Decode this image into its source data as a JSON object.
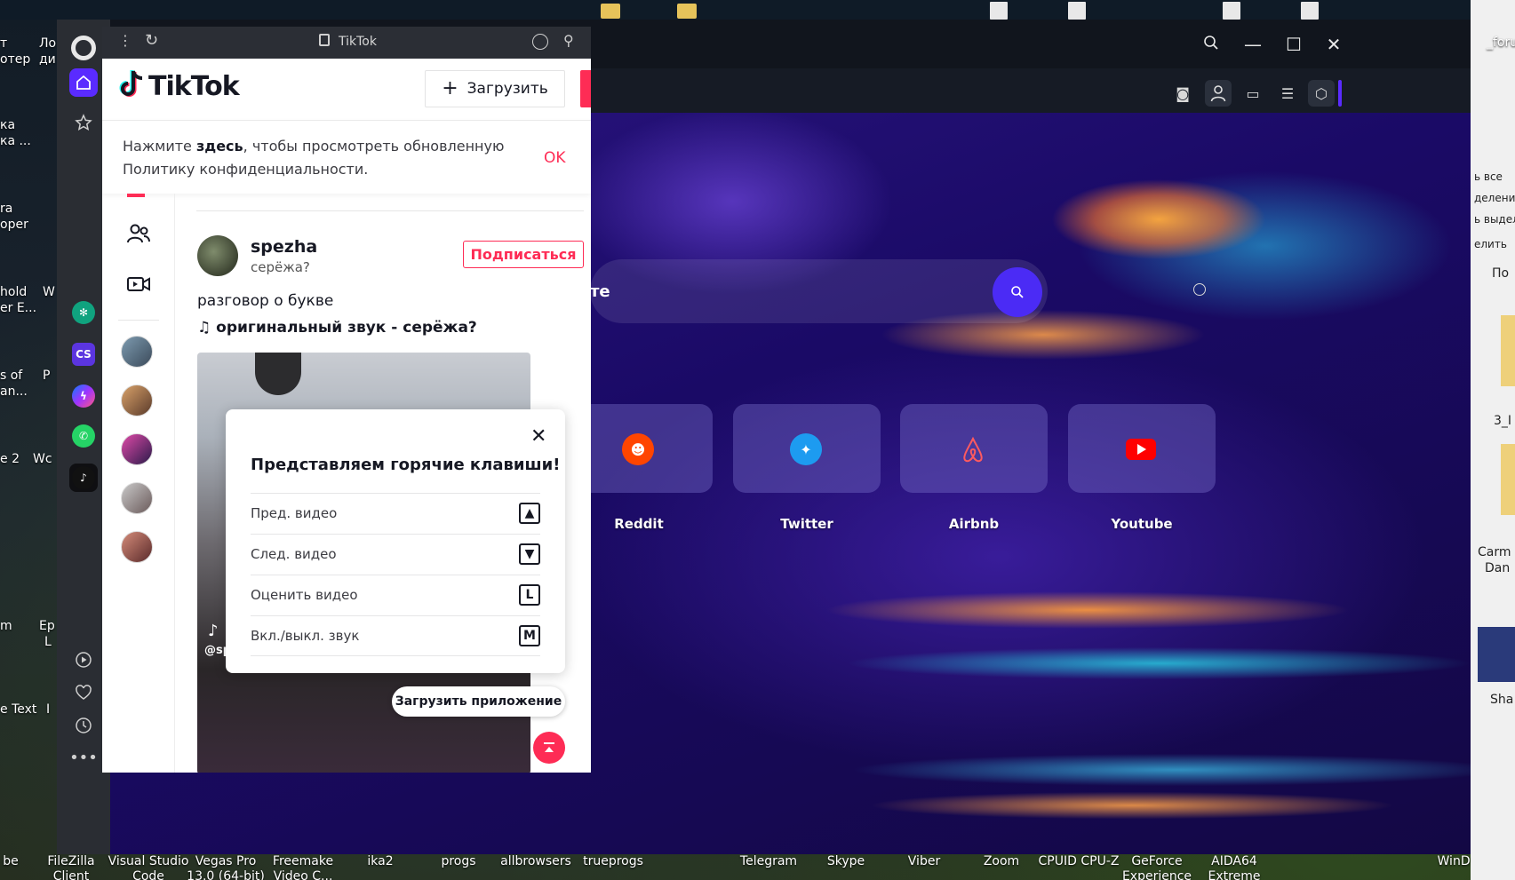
{
  "desktop": {
    "left_labels": [
      "т",
      "отер",
      "ка",
      "ка ...",
      "ra",
      "oper",
      "hold",
      "er E...",
      "s of",
      "an...",
      "e 2",
      "m",
      "e Text",
      "Ло",
      "ди",
      "W",
      "Wc",
      "P",
      "Ep",
      "L",
      "I"
    ],
    "taskbar_labels": [
      {
        "line1": "be",
        "line2": ""
      },
      {
        "line1": "FileZilla",
        "line2": "Client"
      },
      {
        "line1": "Visual Studio",
        "line2": "Code"
      },
      {
        "line1": "Vegas Pro",
        "line2": "13.0 (64-bit)"
      },
      {
        "line1": "Freemake",
        "line2": "Video C..."
      },
      {
        "line1": "ika2",
        "line2": ""
      },
      {
        "line1": "progs",
        "line2": ""
      },
      {
        "line1": "allbrowsers",
        "line2": ""
      },
      {
        "line1": "trueprogs",
        "line2": ""
      },
      {
        "line1": "Telegram",
        "line2": ""
      },
      {
        "line1": "Skype",
        "line2": ""
      },
      {
        "line1": "Viber",
        "line2": ""
      },
      {
        "line1": "Zoom",
        "line2": ""
      },
      {
        "line1": "CPUID CPU-Z",
        "line2": ""
      },
      {
        "line1": "GeForce",
        "line2": "Experience"
      },
      {
        "line1": "AIDA64",
        "line2": "Extreme"
      },
      {
        "line1": "WinDi",
        "line2": ""
      }
    ],
    "right_panel": [
      "_foru",
      "ь все",
      "деление",
      "ь выдел",
      "елить",
      "По",
      "3_I",
      "Carm",
      "Dan",
      "Sha"
    ]
  },
  "opera": {
    "sidebar_apps": [
      "ChatGPT",
      "CS",
      "Messenger",
      "WhatsApp",
      "TikTok"
    ],
    "colors": {
      "accent": "#5a2bff",
      "tiktok_red": "#fe2c55"
    }
  },
  "newtab": {
    "search_placeholder_tail": "те",
    "speed_dials": [
      {
        "label": "Reddit",
        "icon": "reddit-icon"
      },
      {
        "label": "Twitter",
        "icon": "twitter-icon"
      },
      {
        "label": "Airbnb",
        "icon": "airbnb-icon"
      },
      {
        "label": "Youtube",
        "icon": "youtube-icon"
      }
    ]
  },
  "tiktok": {
    "url": "TikTok",
    "logo": "TikTok",
    "upload_label": "Загрузить",
    "privacy": {
      "pre": "Нажмите ",
      "bold": "здесь",
      "post": ", чтобы просмотреть обновленную Политику конфиденциальности.",
      "ok": "OK"
    },
    "post": {
      "author": "spezha",
      "nickname": "серёжа?",
      "follow": "Подписаться",
      "description": "разговор о букве",
      "music": "оригинальный звук - серёжа?",
      "handle": "@sp"
    },
    "hotkeys": {
      "title": "Представляем горячие клавиши!",
      "rows": [
        {
          "label": "Пред. видео",
          "key": "▲"
        },
        {
          "label": "След. видео",
          "key": "▼"
        },
        {
          "label": "Оценить видео",
          "key": "L"
        },
        {
          "label": "Вкл./выкл. звук",
          "key": "M"
        }
      ]
    },
    "get_app": "Загрузить приложение"
  }
}
